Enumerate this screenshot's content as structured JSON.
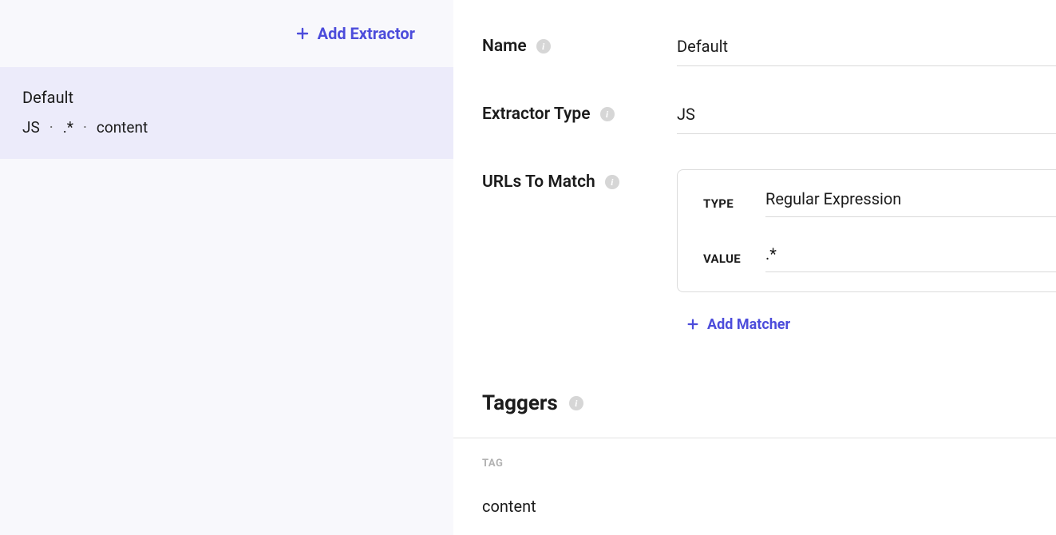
{
  "sidebar": {
    "add_extractor_label": "Add Extractor",
    "item": {
      "title": "Default",
      "type": "JS",
      "pattern": ".*",
      "tag": "content"
    }
  },
  "form": {
    "name_label": "Name",
    "name_value": "Default",
    "extractor_type_label": "Extractor Type",
    "extractor_type_value": "JS",
    "urls_label": "URLs To Match",
    "matcher": {
      "type_label": "TYPE",
      "type_value": "Regular Expression",
      "value_label": "VALUE",
      "value_value": ".*"
    },
    "add_matcher_label": "Add Matcher"
  },
  "taggers": {
    "heading": "Taggers",
    "column_header": "TAG",
    "rows": [
      {
        "tag": "content"
      }
    ]
  }
}
